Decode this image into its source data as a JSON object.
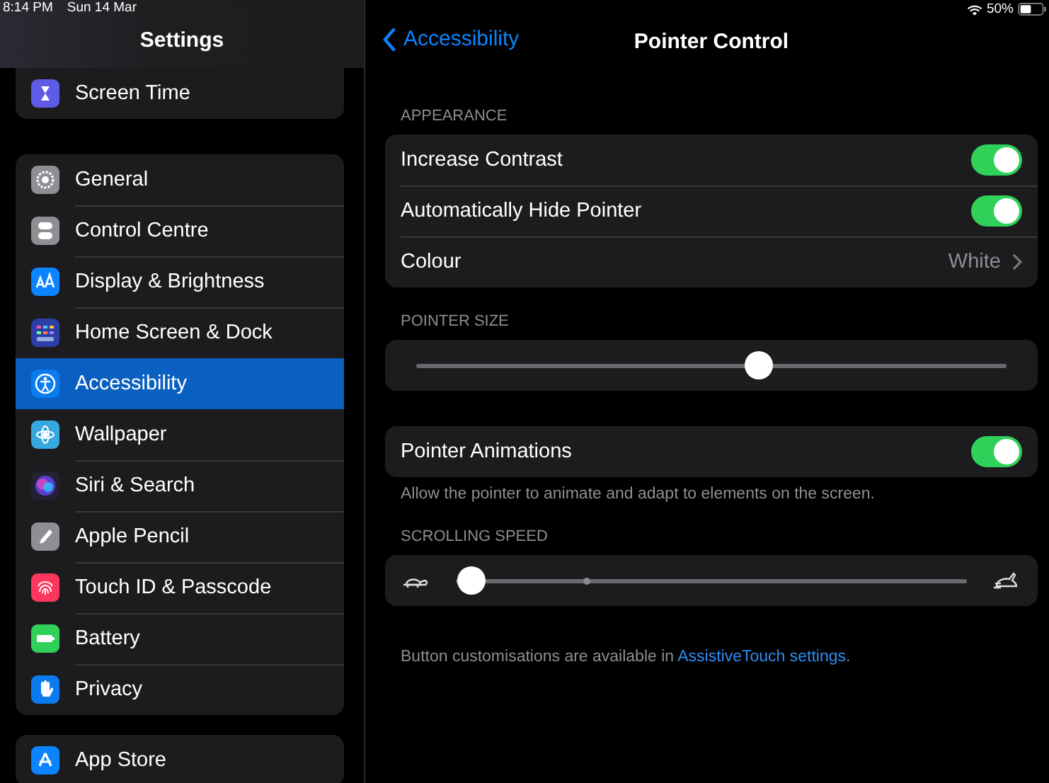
{
  "status_bar": {
    "time": "8:14 PM",
    "date": "Sun 14 Mar",
    "battery": "50%"
  },
  "sidebar": {
    "title": "Settings",
    "groups": [
      {
        "items": [
          {
            "label": "Screen Time",
            "color": "#5e5ce6",
            "selected": false
          }
        ]
      },
      {
        "items": [
          {
            "label": "General",
            "color": "#8e8e93",
            "selected": false
          },
          {
            "label": "Control Centre",
            "color": "#8e8e93",
            "selected": false
          },
          {
            "label": "Display & Brightness",
            "color": "#0a84ff",
            "selected": false
          },
          {
            "label": "Home Screen & Dock",
            "color": "#2c3ea8",
            "selected": false
          },
          {
            "label": "Accessibility",
            "color": "#0a7cf0",
            "selected": true
          },
          {
            "label": "Wallpaper",
            "color": "#35a8e0",
            "selected": false
          },
          {
            "label": "Siri & Search",
            "color": "#222233",
            "selected": false
          },
          {
            "label": "Apple Pencil",
            "color": "#8e8e93",
            "selected": false
          },
          {
            "label": "Touch ID & Passcode",
            "color": "#ff375f",
            "selected": false
          },
          {
            "label": "Battery",
            "color": "#30d158",
            "selected": false
          },
          {
            "label": "Privacy",
            "color": "#0a7cf0",
            "selected": false
          }
        ]
      },
      {
        "items": [
          {
            "label": "App Store",
            "color": "#0a84ff",
            "selected": false
          }
        ]
      }
    ]
  },
  "nav": {
    "back": "Accessibility",
    "title": "Pointer Control"
  },
  "sections": [
    {
      "kind": "rows",
      "header": "APPEARANCE",
      "rows": [
        {
          "kind": "toggle",
          "label": "Increase Contrast",
          "on": true
        },
        {
          "kind": "toggle",
          "label": "Automatically Hide Pointer",
          "on": true
        },
        {
          "kind": "value",
          "label": "Colour",
          "value": "White"
        }
      ]
    },
    {
      "kind": "slider",
      "header": "POINTER SIZE",
      "level": 0.58
    },
    {
      "kind": "rows",
      "rows": [
        {
          "kind": "toggle",
          "label": "Pointer Animations",
          "on": true
        }
      ],
      "footer": "Allow the pointer to animate and adapt to elements on the screen."
    },
    {
      "kind": "speed",
      "header": "SCROLLING SPEED",
      "level": 0.03
    }
  ],
  "note": {
    "text": "Button customisations are available in ",
    "link": "AssistiveTouch settings",
    "end": "."
  }
}
